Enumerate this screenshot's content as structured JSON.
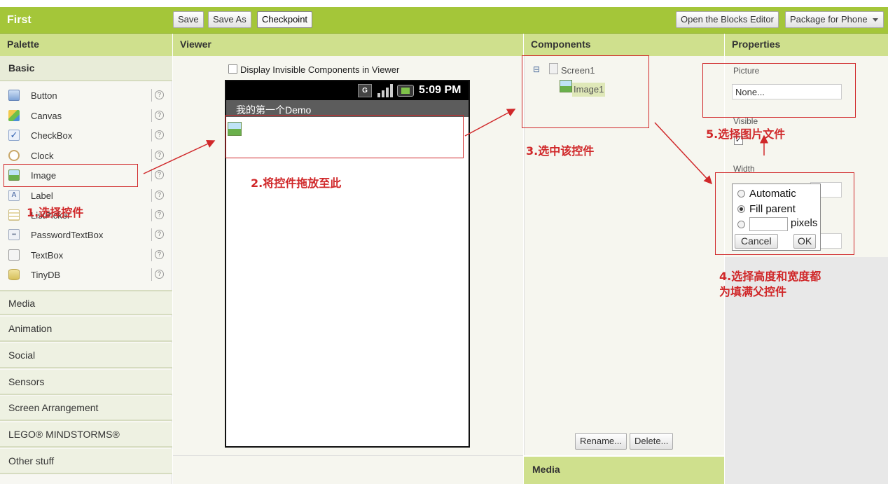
{
  "app": {
    "title": "First"
  },
  "toolbar": {
    "save_label": "Save",
    "save_as_label": "Save As",
    "checkpoint_label": "Checkpoint",
    "blocks_editor_label": "Open the Blocks Editor",
    "package_label": "Package for Phone"
  },
  "palette": {
    "header": "Palette",
    "basic_label": "Basic",
    "basic_items": [
      {
        "label": "Button",
        "icon": "button-icon"
      },
      {
        "label": "Canvas",
        "icon": "canvas-icon"
      },
      {
        "label": "CheckBox",
        "icon": "checkbox-icon"
      },
      {
        "label": "Clock",
        "icon": "clock-icon"
      },
      {
        "label": "Image",
        "icon": "image-icon"
      },
      {
        "label": "Label",
        "icon": "label-icon"
      },
      {
        "label": "ListPicker",
        "icon": "listpicker-icon"
      },
      {
        "label": "PasswordTextBox",
        "icon": "password-icon"
      },
      {
        "label": "TextBox",
        "icon": "textbox-icon"
      },
      {
        "label": "TinyDB",
        "icon": "database-icon"
      }
    ],
    "help_glyph": "?",
    "sections": [
      "Media",
      "Animation",
      "Social",
      "Sensors",
      "Screen Arrangement",
      "LEGO® MINDSTORMS®",
      "Other stuff"
    ]
  },
  "viewer": {
    "header": "Viewer",
    "display_invisible_label": "Display Invisible Components in Viewer",
    "status_time": "5:09 PM",
    "screen_title": "我的第一个Demo"
  },
  "components": {
    "header": "Components",
    "tree_toggle": "⊟",
    "screen_label": "Screen1",
    "image_label": "Image1",
    "rename_label": "Rename...",
    "delete_label": "Delete...",
    "media_header": "Media"
  },
  "properties": {
    "header": "Properties",
    "picture_label": "Picture",
    "picture_value": "None...",
    "visible_label": "Visible",
    "visible_checked": true,
    "width_label": "Width",
    "width_options": {
      "automatic": "Automatic",
      "fill_parent": "Fill parent",
      "pixels": "pixels"
    },
    "width_selected": "fill_parent",
    "cancel_label": "Cancel",
    "ok_label": "OK"
  },
  "annotations": {
    "step1": "1.选择控件",
    "step2": "2.将控件拖放至此",
    "step3": "3.选中该控件",
    "step4_line1": "4.选择高度和宽度都",
    "step4_line2": "为填满父控件",
    "step5": "5.选择图片文件"
  },
  "colors": {
    "brand_green": "#a4c639",
    "header_green": "#cfe08d",
    "annotation_red": "#d0282a"
  }
}
